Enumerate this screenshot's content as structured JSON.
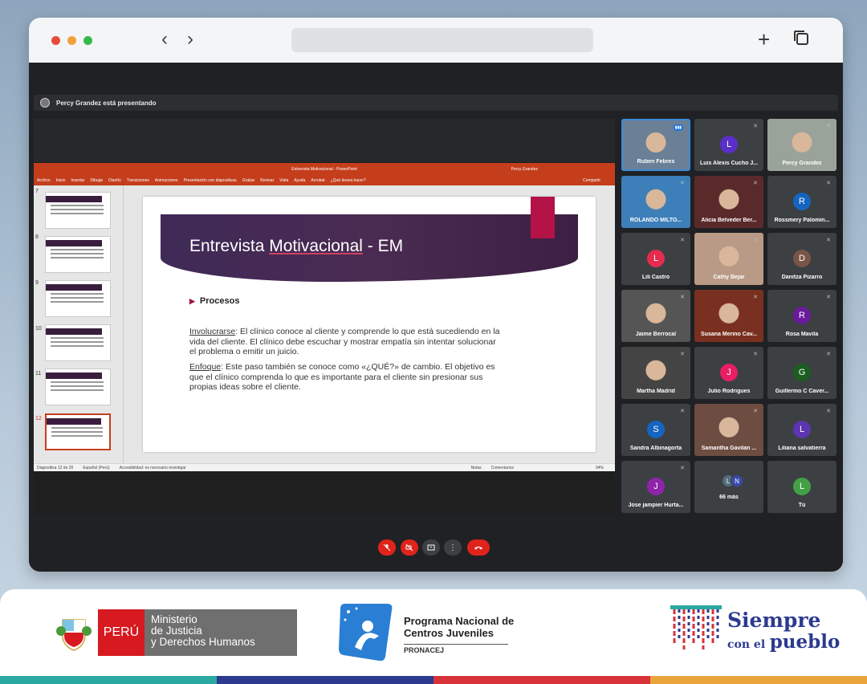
{
  "browser": {
    "traffic_lights": [
      "#e84b3c",
      "#f2a13a",
      "#36b94a"
    ],
    "back_icon": "chevron-left-icon",
    "forward_icon": "chevron-right-icon",
    "new_tab_icon": "plus-icon",
    "tabs_icon": "copy-icon"
  },
  "meet": {
    "presenting_text": "Percy Grandez está presentando",
    "controls": [
      "mic-off-icon",
      "camera-off-icon",
      "present-icon",
      "more-vert-icon",
      "hang-up-icon"
    ]
  },
  "ppt": {
    "window_title": "Entrevista Motivacional  -  PowerPoint",
    "user": "Percy Grandez",
    "tabs": [
      "Archivo",
      "Inicio",
      "Insertar",
      "Dibujar",
      "Diseño",
      "Transiciones",
      "Animaciones",
      "Presentación con diapositivas",
      "Grabar",
      "Revisar",
      "Vista",
      "Ayuda",
      "Acrobat",
      "¿Qué desea hacer?"
    ],
    "share": "Compartir",
    "thumb_numbers": [
      "7",
      "8",
      "9",
      "10",
      "11",
      "12"
    ],
    "status": {
      "slide": "Diapositiva 12 de 20",
      "language": "Español (Perú)",
      "accessibility": "Accesibilidad: es necesario investigar",
      "notes": "Notas",
      "comments": "Comentarios",
      "zoom": "94%"
    }
  },
  "slide": {
    "title_pre": "Entrevista ",
    "title_underlined": "Motivacional",
    "title_post": " - EM",
    "bullet": "Procesos",
    "p1_term": "Involucrarse",
    "p1_text": ": El clínico conoce al cliente y comprende lo que está sucediendo en la vida del cliente. El clínico debe escuchar y mostrar empatía sin intentar solucionar el problema o emitir un juicio.",
    "p2_term": "Enfoque",
    "p2_text": ": Este paso también se conoce como «¿QUÉ?» de cambio. El objetivo es que el clínico comprenda lo que es importante para el cliente sin presionar sus propias ideas sobre el cliente."
  },
  "participants": [
    {
      "name": "Ruben Febres",
      "photo": true,
      "active": true,
      "color": "#6b7f96"
    },
    {
      "name": "Luis Alexis Cucho J...",
      "initial": "L",
      "color": "#5b2fc9"
    },
    {
      "name": "Percy Grandez",
      "photo": true,
      "color": "#9aa39a"
    },
    {
      "name": "ROLANDO MILTO...",
      "photo": true,
      "color": "#3d7fb8"
    },
    {
      "name": "Alicia Belveder Ber...",
      "photo": true,
      "color": "#5a2a2a"
    },
    {
      "name": "Rossmery Palomin...",
      "initial": "R",
      "color": "#1565c0"
    },
    {
      "name": "Lili Castro",
      "initial": "L",
      "color": "#e52b50"
    },
    {
      "name": "Cathy Bejar",
      "photo": true,
      "color": "#b89a86"
    },
    {
      "name": "Danitza Pizarro",
      "initial": "D",
      "color": "#795548"
    },
    {
      "name": "Jaime Berrocal",
      "photo": true,
      "color": "#555"
    },
    {
      "name": "Susana Merino Cav...",
      "photo": true,
      "color": "#7a3020"
    },
    {
      "name": "Rosa Mavila",
      "initial": "R",
      "color": "#6a1b9a"
    },
    {
      "name": "Martha Madrid",
      "photo": true,
      "color": "#444"
    },
    {
      "name": "Julio Rodrigues",
      "initial": "J",
      "color": "#e91e63"
    },
    {
      "name": "Guillermo C Caver...",
      "initial": "G",
      "color": "#1b5e20"
    },
    {
      "name": "Sandra Albinagorta",
      "initial": "S",
      "color": "#1565c0"
    },
    {
      "name": "Samantha Gavilan ...",
      "photo": true,
      "color": "#6d4c41"
    },
    {
      "name": "Liliana salvatierra",
      "initial": "L",
      "color": "#5e35b1"
    },
    {
      "name": "Jose jampier Hurta...",
      "initial": "J",
      "color": "#8e24aa"
    },
    {
      "name": "66 más",
      "initials": [
        "L",
        "N"
      ],
      "color": "#546e7a"
    },
    {
      "name": "Tú",
      "initial": "L",
      "color": "#43a047"
    }
  ],
  "footer": {
    "peru": "PERÚ",
    "ministry": [
      "Ministerio",
      "de Justicia",
      "y Derechos Humanos"
    ],
    "pronacej_title": [
      "Programa Nacional de",
      "Centros Juveniles"
    ],
    "pronacej_sub": "PRONACEJ",
    "siempre": "Siempre",
    "con_el": "con el",
    "pueblo": "pueblo",
    "stripe_colors": [
      "#2aa9a2",
      "#2c3a8f",
      "#d7323a",
      "#e9a43b"
    ]
  }
}
